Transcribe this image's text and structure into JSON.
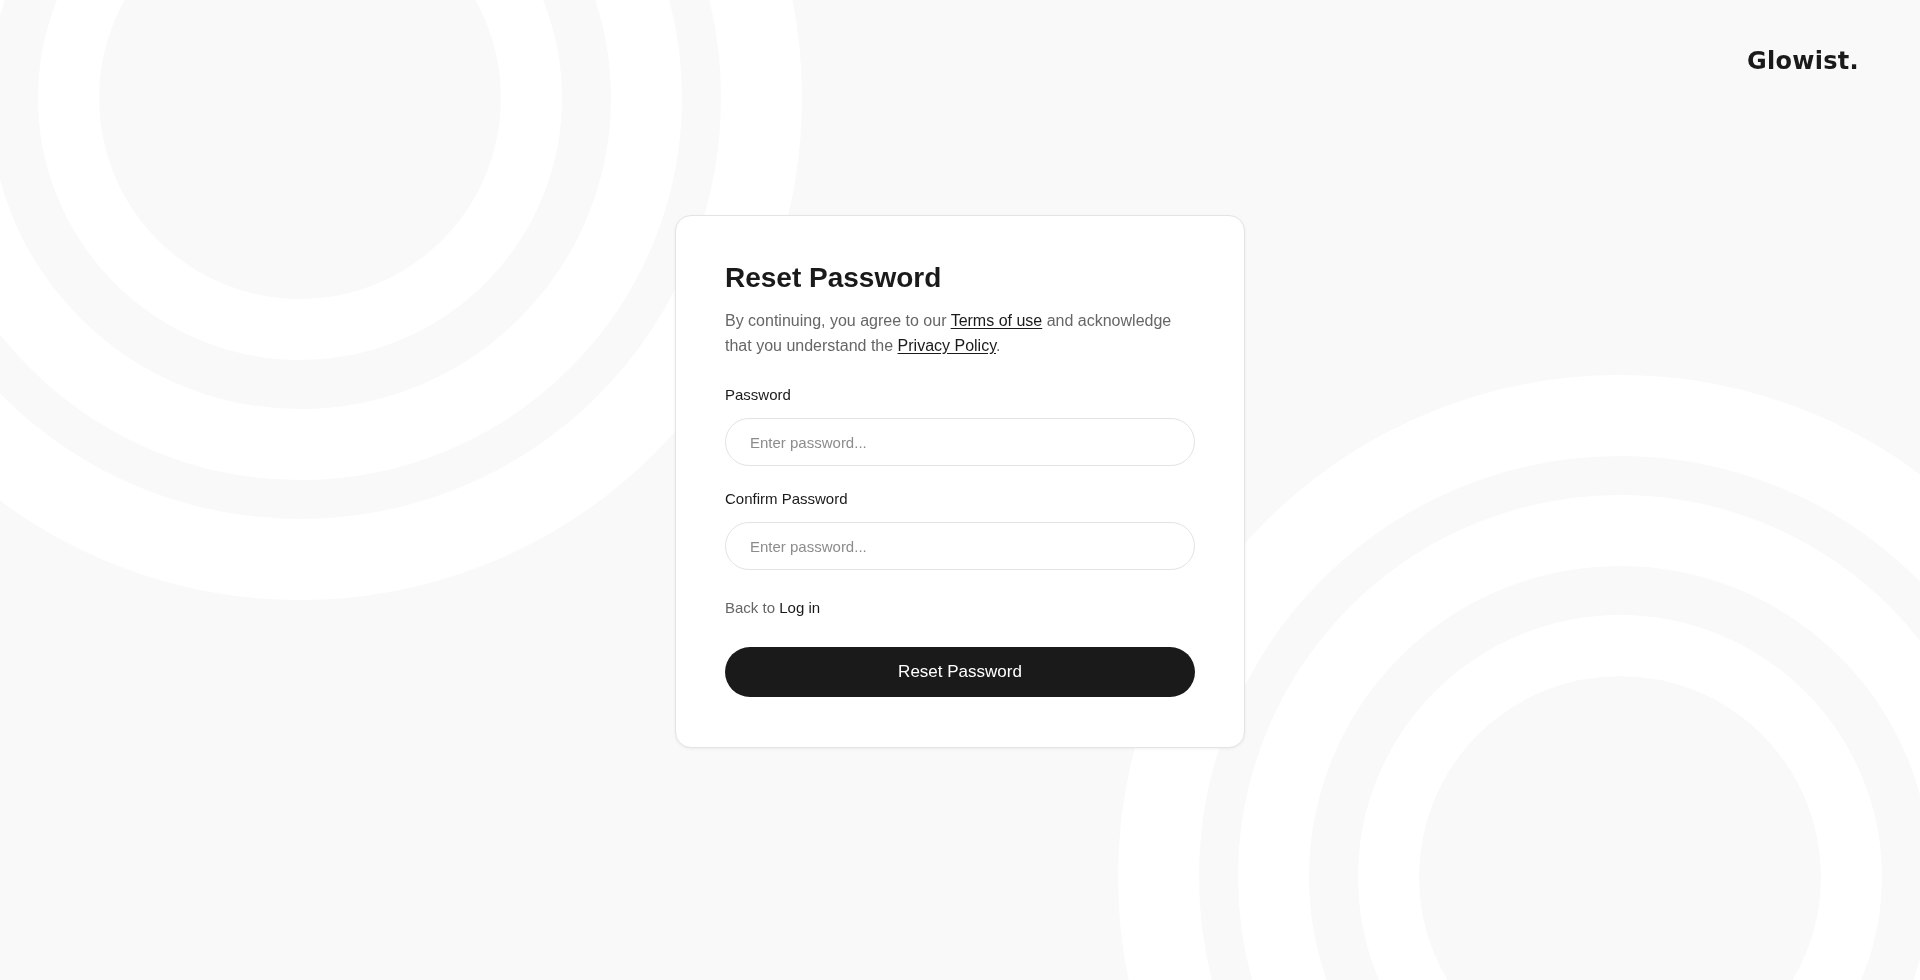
{
  "brand": {
    "logo": "Glowist."
  },
  "card": {
    "title": "Reset Password",
    "notice": [
      {
        "kind": "text",
        "text": "By continuing, you agree to our "
      },
      {
        "kind": "link",
        "text": "Terms of use"
      },
      {
        "kind": "text",
        "text": " and acknowledge that you understand the "
      },
      {
        "kind": "link",
        "text": "Privacy Policy"
      },
      {
        "kind": "text",
        "text": "."
      }
    ],
    "fields": [
      {
        "label": "Password",
        "placeholder": "Enter password..."
      },
      {
        "label": "Confirm Password",
        "placeholder": "Enter password..."
      }
    ],
    "back_link": {
      "prefix": "Back to",
      "link": "Log in"
    },
    "submit_button": "Reset Password"
  }
}
